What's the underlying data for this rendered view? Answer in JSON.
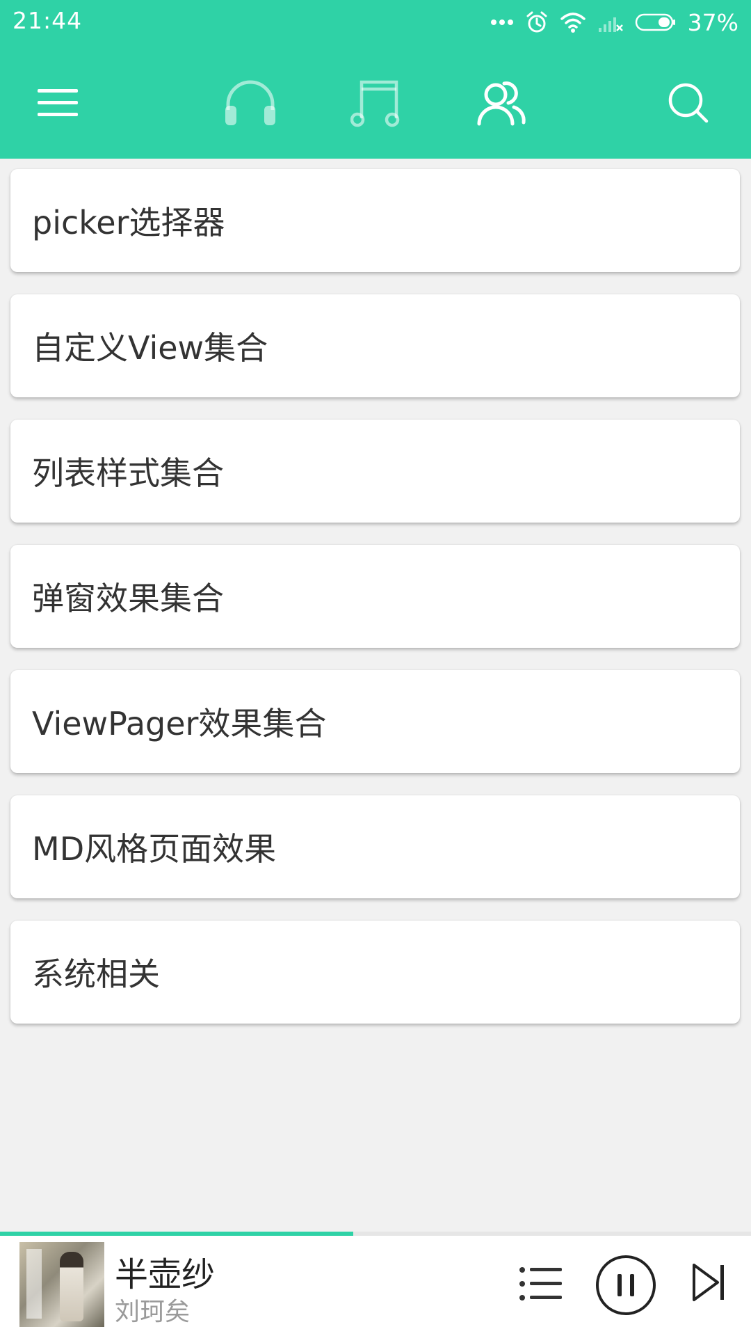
{
  "status_bar": {
    "time": "21:44",
    "battery_percent": "37%",
    "battery_level": 0.37,
    "icons": [
      "more-dots-icon",
      "alarm-icon",
      "wifi-icon",
      "no-signal-icon",
      "battery-icon"
    ]
  },
  "toolbar": {
    "icons": [
      "menu-icon",
      "headphones-icon",
      "music-note-icon",
      "people-icon",
      "search-icon"
    ],
    "active_tab": "people-icon",
    "accent_color": "#2fd2a6"
  },
  "list": {
    "items": [
      {
        "label": "picker选择器"
      },
      {
        "label": "自定义View集合"
      },
      {
        "label": "列表样式集合"
      },
      {
        "label": "弹窗效果集合"
      },
      {
        "label": "ViewPager效果集合"
      },
      {
        "label": "MD风格页面效果"
      },
      {
        "label": "系统相关"
      }
    ]
  },
  "player": {
    "song_title": "半壶纱",
    "artist": "刘珂矣",
    "progress": 0.47,
    "icons": [
      "album-cover",
      "playlist-icon",
      "pause-icon",
      "next-icon"
    ]
  }
}
